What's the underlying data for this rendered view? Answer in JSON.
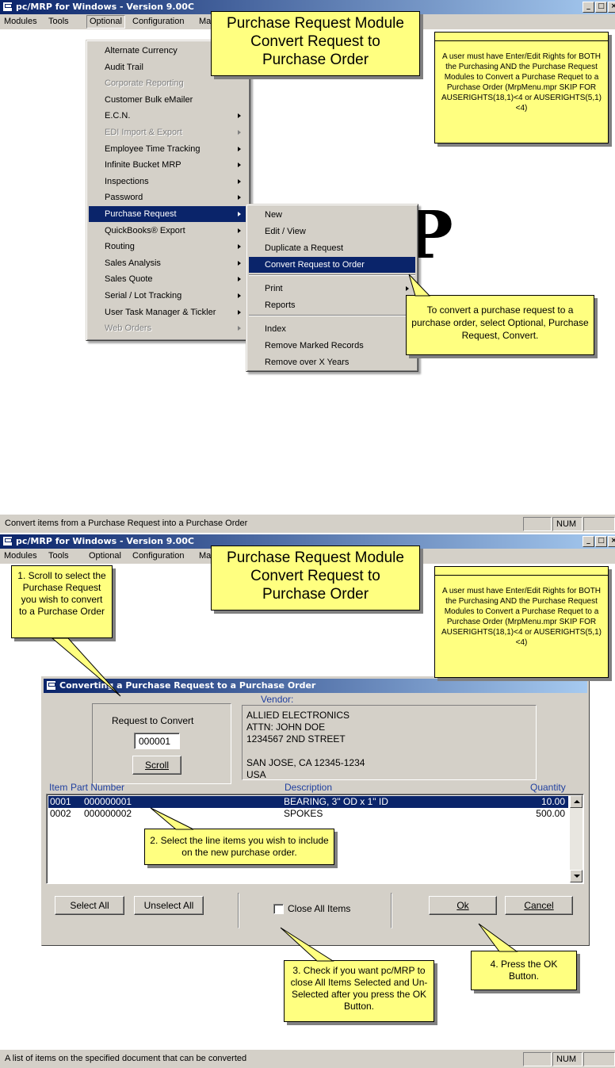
{
  "app": {
    "title": "pc/MRP for Windows - Version 9.00C",
    "window_controls": [
      "_",
      "□",
      "×"
    ]
  },
  "menubar": {
    "modules": "Modules",
    "tools": "Tools",
    "optional": "Optional",
    "configuration": "Configuration",
    "truncated": "Ma"
  },
  "optional_menu": {
    "items": [
      {
        "label": "Alternate Currency"
      },
      {
        "label": "Audit Trail"
      },
      {
        "label": "Corporate Reporting"
      },
      {
        "label": "Customer Bulk eMailer"
      },
      {
        "label": "E.C.N."
      },
      {
        "label": "EDI Import & Export"
      },
      {
        "label": "Employee Time Tracking"
      },
      {
        "label": "Infinite Bucket MRP"
      },
      {
        "label": "Inspections"
      },
      {
        "label": "Password"
      },
      {
        "label": "Purchase Request"
      },
      {
        "label": "QuickBooks® Export"
      },
      {
        "label": "Routing"
      },
      {
        "label": "Sales Analysis"
      },
      {
        "label": "Sales Quote"
      },
      {
        "label": "Serial / Lot Tracking"
      },
      {
        "label": "User Task Manager & Tickler"
      },
      {
        "label": "Web Orders"
      }
    ]
  },
  "purchase_request_menu": {
    "items": [
      {
        "label": "New"
      },
      {
        "label": "Edit / View"
      },
      {
        "label": "Duplicate a Request"
      },
      {
        "label": "Convert Request to Order"
      },
      {
        "label": "Print"
      },
      {
        "label": "Reports"
      },
      {
        "label": "Index"
      },
      {
        "label": "Remove Marked Records"
      },
      {
        "label": "Remove over X Years"
      }
    ]
  },
  "background_letter": "P",
  "callouts": {
    "module_title": [
      "Purchase Request Module",
      "Convert Request to",
      "Purchase Order"
    ],
    "rights_note": "A user must have Enter/Edit Rights for BOTH the Purchasing AND the Purchase Request Modules to Convert a Purchase Requet to a Purchase Order (MrpMenu.mpr SKIP FOR AUSERIGHTS(18,1)<4 or AUSERIGHTS(5,1)<4)",
    "convert_tip": "To convert a purchase request to a purchase order, select Optional, Purchase Request, Convert.",
    "step1": "1. Scroll to select the Purchase Request you wish to convert to a Purchase Order",
    "step2": "2. Select the line items you wish to include on the new purchase order.",
    "step3": "3. Check if you want pc/MRP to close All Items Selected and Un-Selected after you press the OK Button.",
    "step4": "4. Press the OK Button."
  },
  "status1": {
    "text": "Convert items from a Purchase Request into a Purchase Order",
    "num": "NUM"
  },
  "status2": {
    "text": "A list of items on the specified document that can be converted",
    "num": "NUM"
  },
  "dialog": {
    "title": "Converting a Purchase Request to a Purchase Order",
    "request_label": "Request to Convert",
    "request_value": "000001",
    "scroll_button": "Scroll",
    "vendor_label": "Vendor:",
    "vendor_lines": [
      "ALLIED ELECTRONICS",
      "ATTN: JOHN DOE",
      "1234567  2ND STREET",
      "",
      "SAN JOSE, CA 12345-1234",
      "USA"
    ],
    "columns": {
      "item": "Item",
      "part": "Part Number",
      "description": "Description",
      "quantity": "Quantity"
    },
    "rows": [
      {
        "item": "0001",
        "part": "000000001",
        "description": "BEARING, 3\" OD x 1\" ID",
        "quantity": "10.00"
      },
      {
        "item": "0002",
        "part": "000000002",
        "description": "SPOKES",
        "quantity": "500.00"
      }
    ],
    "select_all": "Select All",
    "unselect_all": "Unselect All",
    "close_all_items": "Close All Items",
    "ok": "Ok",
    "cancel": "Cancel"
  }
}
